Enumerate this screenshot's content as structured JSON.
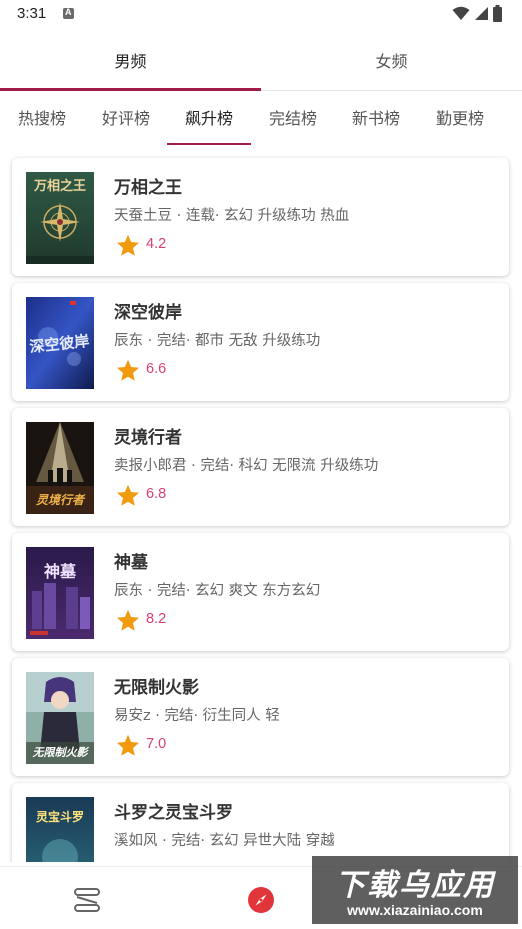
{
  "status_bar": {
    "time": "3:31",
    "notification_icon": "a-notification-icon",
    "icons": [
      "wifi-icon",
      "signal-icon",
      "battery-icon"
    ]
  },
  "gender_tabs": [
    {
      "label": "男频",
      "active": true
    },
    {
      "label": "女频",
      "active": false
    }
  ],
  "rank_tabs": [
    {
      "label": "热搜榜",
      "active": false
    },
    {
      "label": "好评榜",
      "active": false
    },
    {
      "label": "飙升榜",
      "active": true
    },
    {
      "label": "完结榜",
      "active": false
    },
    {
      "label": "新书榜",
      "active": false
    },
    {
      "label": "勤更榜",
      "active": false
    }
  ],
  "books": [
    {
      "title": "万相之王",
      "meta": "天蚕土豆 · 连载· 玄幻 升级练功 热血",
      "rating": "4.2",
      "cover_text": "万相之王"
    },
    {
      "title": "深空彼岸",
      "meta": "辰东 · 完结· 都市 无敌 升级练功",
      "rating": "6.6",
      "cover_text": "深空彼岸"
    },
    {
      "title": "灵境行者",
      "meta": "卖报小郎君 · 完结· 科幻 无限流 升级练功",
      "rating": "6.8",
      "cover_text": "灵境行者"
    },
    {
      "title": "神墓",
      "meta": "辰东 · 完结· 玄幻 爽文 东方玄幻",
      "rating": "8.2",
      "cover_text": "神墓"
    },
    {
      "title": "无限制火影",
      "meta": "易安z · 完结· 衍生同人 轻",
      "rating": "7.0",
      "cover_text": "无限制火影"
    },
    {
      "title": "斗罗之灵宝斗罗",
      "meta": "溪如风 · 完结· 玄幻 异世大陆 穿越",
      "rating": "",
      "cover_text": "灵宝斗罗"
    }
  ],
  "bottom_nav": [
    {
      "name": "bookshelf",
      "icon": "bookshelf-icon"
    },
    {
      "name": "discover",
      "icon": "compass-icon"
    }
  ],
  "watermark": {
    "logo": "下载乌应用",
    "url": "www.xiazainiao.com"
  },
  "colors": {
    "accent": "#a01b4a",
    "rating": "#d94070",
    "star": "#f29a0e",
    "nav_active": "#e0363a"
  }
}
